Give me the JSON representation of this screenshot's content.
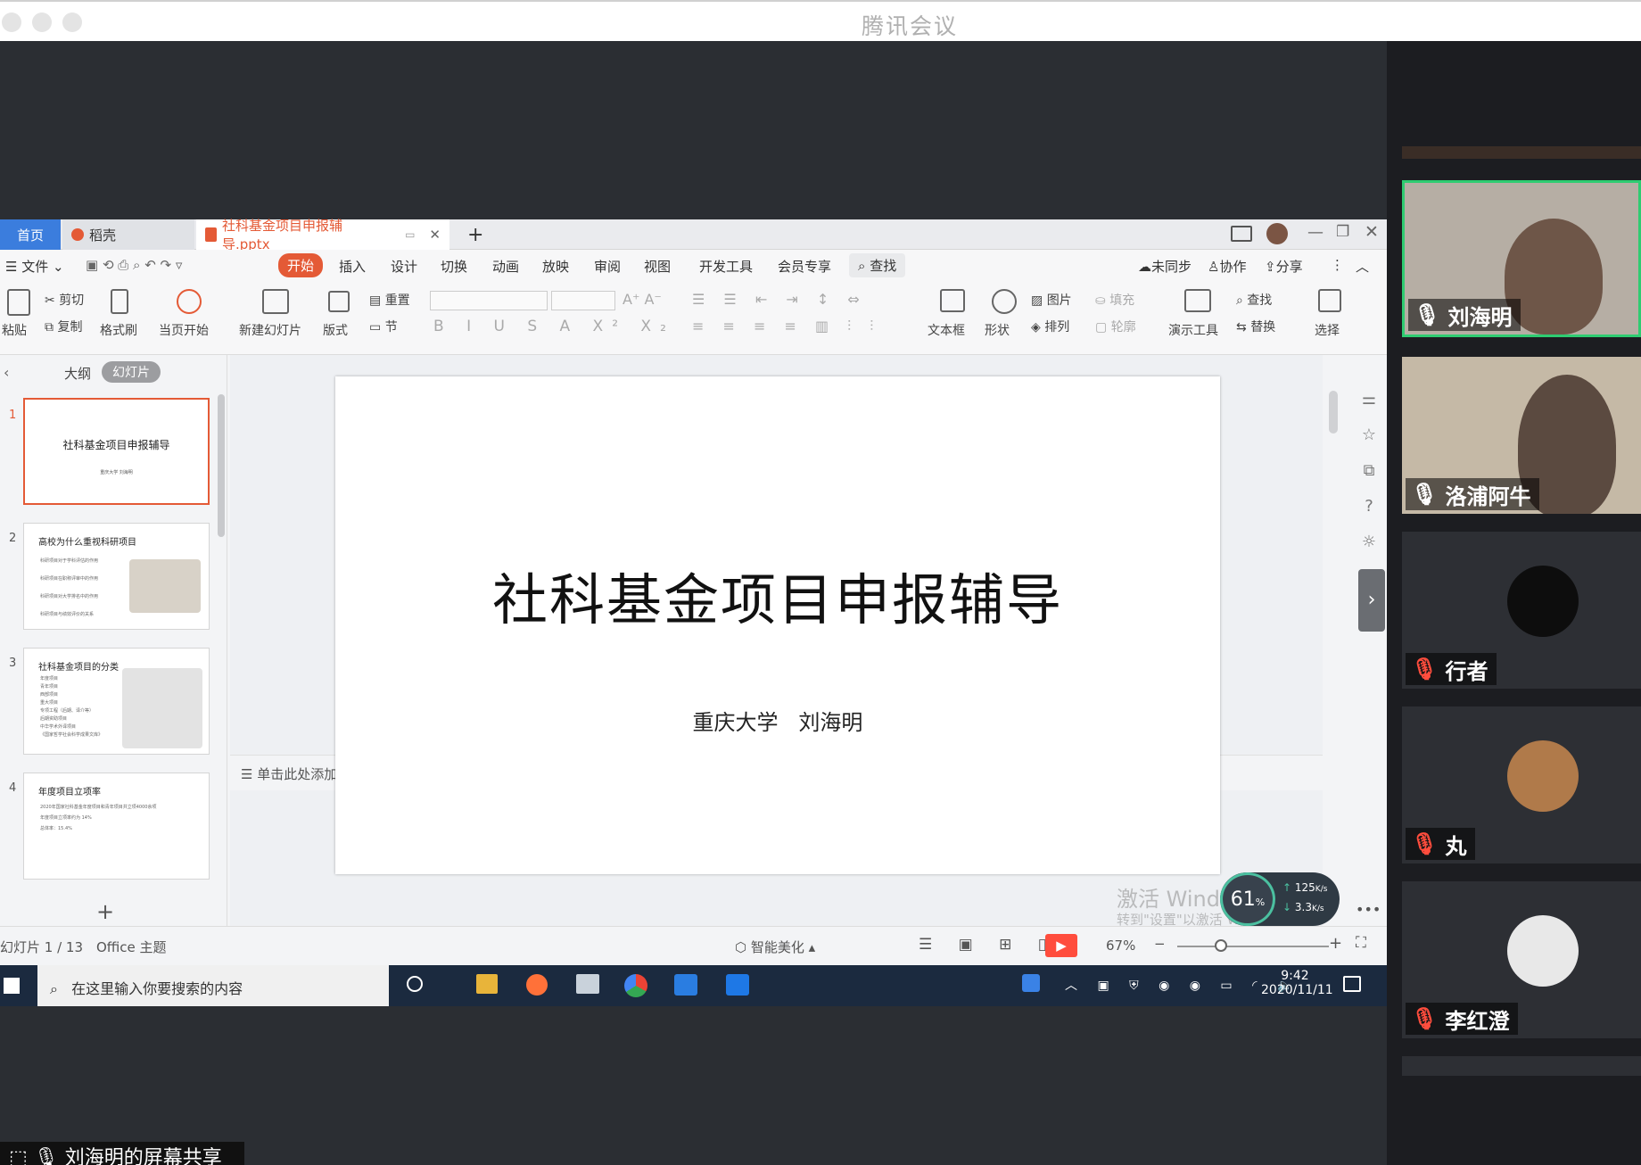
{
  "app": {
    "title": "腾讯会议"
  },
  "wps": {
    "tabs": {
      "home": "首页",
      "daoke": "稻壳",
      "file": "社科基金项目申报辅导.pptx",
      "add": "+"
    },
    "menu": {
      "file": "文件",
      "items": [
        "开始",
        "插入",
        "设计",
        "切换",
        "动画",
        "放映",
        "审阅",
        "视图",
        "开发工具",
        "会员专享"
      ],
      "search": "查找",
      "sync": "未同步",
      "collab": "协作",
      "share": "分享"
    },
    "ribbon": {
      "paste": "粘贴",
      "cut": "剪切",
      "copy": "复制",
      "format_painter": "格式刷",
      "play_from_current": "当页开始",
      "new_slide": "新建幻灯片",
      "layout": "版式",
      "reset": "重置",
      "section": "节",
      "textbox": "文本框",
      "shape": "形状",
      "picture": "图片",
      "arrange": "排列",
      "fill": "填充",
      "outline": "轮廓",
      "present_tools": "演示工具",
      "find": "查找",
      "replace": "替换",
      "select": "选择"
    },
    "pane": {
      "outline": "大纲",
      "slides": "幻灯片",
      "add": "+"
    },
    "thumbs": [
      {
        "num": "1",
        "title": "社科基金项目申报辅导",
        "sub": "重庆大学  刘海明"
      },
      {
        "num": "2",
        "title": "高校为什么重视科研项目",
        "bullets": [
          "科研项目对于学科评估的作用",
          "科研项目在职称评审中的作用",
          "科研项目对大学排名中的作用",
          "科研项目与绩效评价的关系"
        ]
      },
      {
        "num": "3",
        "title": "社科基金项目的分类",
        "bullets": [
          "年度项目",
          "青年项目",
          "西部项目",
          "重大项目",
          "专项工程（后期、译介等）",
          "后期资助项目",
          "中华学术外译项目",
          "《国家哲学社会科学成果文库》"
        ]
      },
      {
        "num": "4",
        "title": "年度项目立项率",
        "bullets": [
          "2020年国家社科基金年度项目和青年项目共立项4000余项",
          "年度项目立项率约为 14%",
          "总体率：15.4%"
        ]
      }
    ],
    "slide": {
      "title": "社科基金项目申报辅导",
      "subtitle": "重庆大学   刘海明"
    },
    "notes": "单击此处添加备注",
    "status": {
      "slide_counter": "幻灯片 1 / 13",
      "theme": "Office 主题",
      "beautify": "智能美化",
      "zoom": "67%",
      "zoom_minus": "−",
      "zoom_plus": "+"
    },
    "net": {
      "cpu": "61",
      "unit": "%",
      "up": "125",
      "down": "3.3",
      "rate_unit": "K/s"
    },
    "watermark": {
      "line1": "激活 Windows",
      "line2": "转到\"设置\"以激活 Windows。"
    }
  },
  "taskbar": {
    "search": "在这里输入你要搜索的内容",
    "time": "9:42",
    "date": "2020/11/11"
  },
  "participants": [
    {
      "name": "刘海明",
      "mic": "on"
    },
    {
      "name": "洛浦阿牛",
      "mic": "on"
    },
    {
      "name": "行者",
      "mic": "muted"
    },
    {
      "name": "丸",
      "mic": "muted"
    },
    {
      "name": "李红澄",
      "mic": "muted"
    }
  ],
  "share_label": "刘海明的屏幕共享",
  "colors": {
    "accent": "#e45a36",
    "wps_blue": "#3b7ddd",
    "active_green": "#2ecc71",
    "present_red": "#ff4d3d"
  }
}
